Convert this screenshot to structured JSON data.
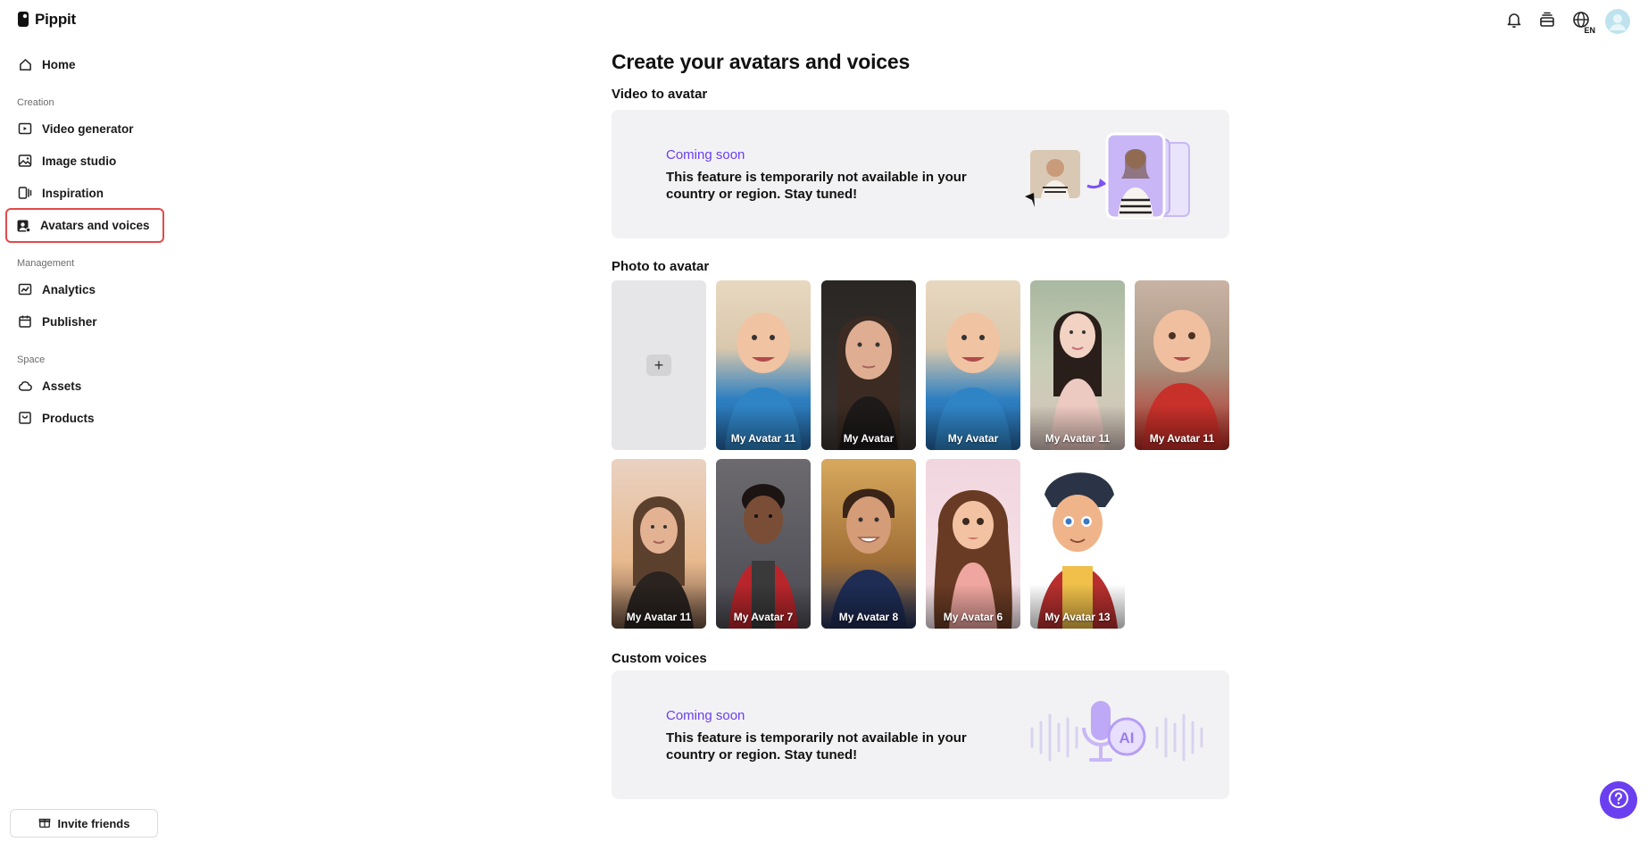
{
  "brand": {
    "name": "Pippit"
  },
  "sidebar": {
    "home": "Home",
    "sections": {
      "creation": "Creation",
      "management": "Management",
      "space": "Space"
    },
    "items": {
      "video_generator": "Video generator",
      "image_studio": "Image studio",
      "inspiration": "Inspiration",
      "avatars_voices": "Avatars and voices",
      "analytics": "Analytics",
      "publisher": "Publisher",
      "assets": "Assets",
      "products": "Products"
    },
    "invite": "Invite friends"
  },
  "topbar": {
    "language": "EN"
  },
  "main": {
    "title": "Create your avatars and voices",
    "video_to_avatar": {
      "heading": "Video to avatar",
      "status": "Coming soon",
      "message": "This feature is temporarily not available in your country or region. Stay tuned!"
    },
    "photo_to_avatar": {
      "heading": "Photo to avatar",
      "avatars": [
        {
          "name": "My Avatar 11"
        },
        {
          "name": "My Avatar"
        },
        {
          "name": "My Avatar"
        },
        {
          "name": "My Avatar 11"
        },
        {
          "name": "My Avatar 11"
        },
        {
          "name": "My Avatar 11"
        },
        {
          "name": "My Avatar 7"
        },
        {
          "name": "My Avatar 8"
        },
        {
          "name": "My Avatar 6"
        },
        {
          "name": "My Avatar 13"
        }
      ]
    },
    "custom_voices": {
      "heading": "Custom voices",
      "status": "Coming soon",
      "message": "This feature is temporarily not available in your country or region. Stay tuned!"
    }
  },
  "colors": {
    "accent": "#6a3ff0",
    "active_outline": "#e24a4a",
    "card_bg": "#f2f2f4"
  }
}
